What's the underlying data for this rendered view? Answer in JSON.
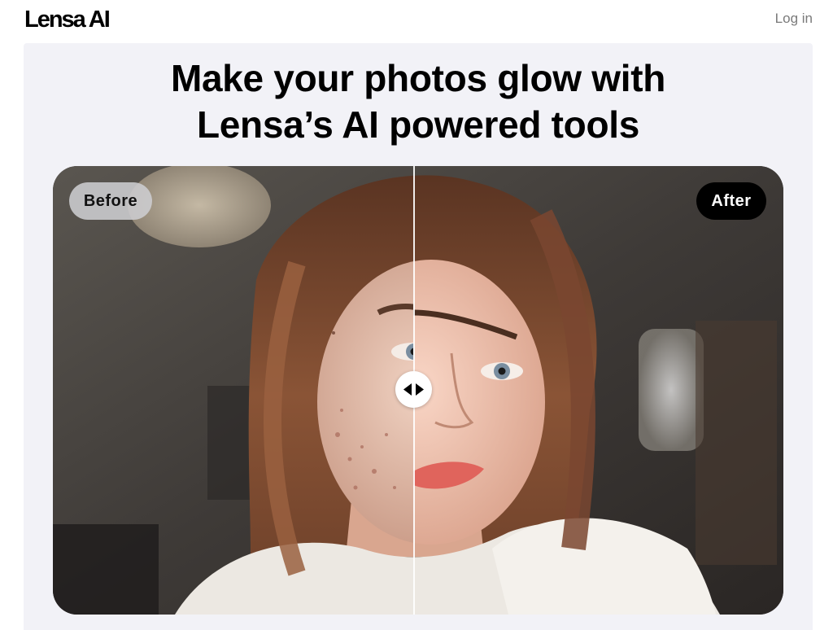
{
  "header": {
    "logo": "Lensa AI",
    "login_label": "Log in"
  },
  "hero": {
    "headline_line1": "Make your photos glow with",
    "headline_line2": "Lensa’s AI powered tools"
  },
  "comparison": {
    "before_label": "Before",
    "after_label": "After",
    "divider_position": 0.494,
    "handle_icon": "left-right-arrows-icon"
  },
  "colors": {
    "panel_background": "#f2f2f7",
    "after_badge": "#000000",
    "before_badge": "#cdcdd0",
    "login_text": "#7a7a7a"
  }
}
